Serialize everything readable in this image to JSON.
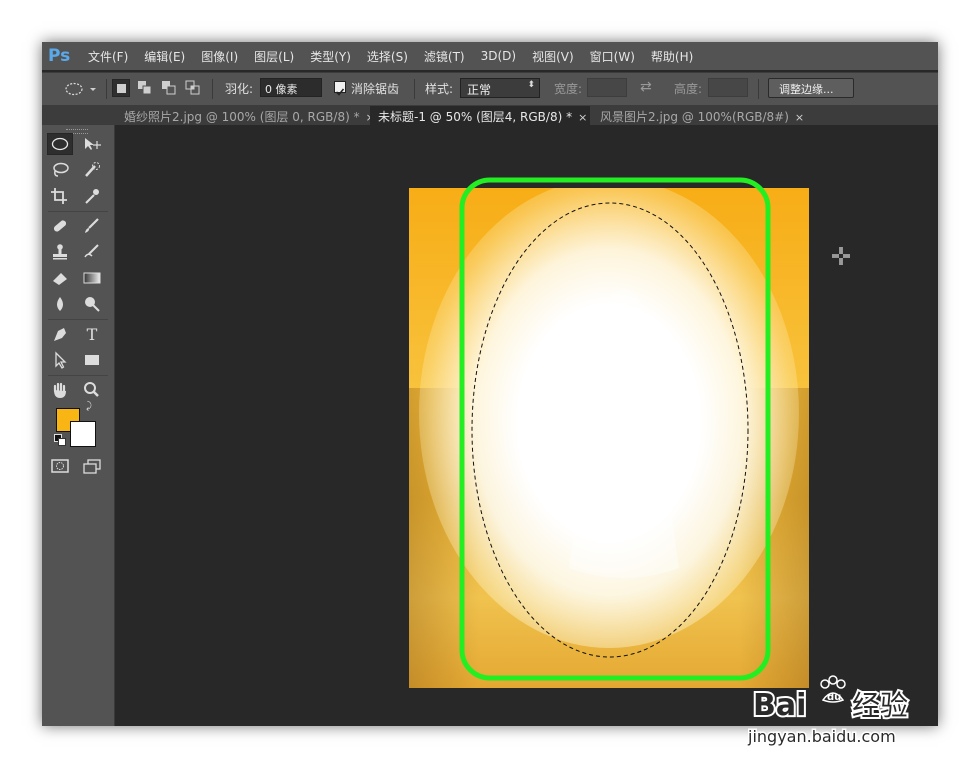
{
  "app": {
    "logo": "Ps"
  },
  "menu": [
    "文件(F)",
    "编辑(E)",
    "图像(I)",
    "图层(L)",
    "类型(Y)",
    "选择(S)",
    "滤镜(T)",
    "3D(D)",
    "视图(V)",
    "窗口(W)",
    "帮助(H)"
  ],
  "options": {
    "feather_label": "羽化:",
    "feather_value": "0 像素",
    "antialias_label": "消除锯齿",
    "antialias_checked": true,
    "style_label": "样式:",
    "style_value": "正常",
    "width_label": "宽度:",
    "height_label": "高度:",
    "refine_edge": "调整边缘..."
  },
  "tabs": [
    {
      "label": "婚纱照片2.jpg @ 100% (图层 0, RGB/8) *",
      "close": "×",
      "active": false
    },
    {
      "label": "未标题-1 @ 50% (图层4, RGB/8) *",
      "close": "×",
      "active": true
    },
    {
      "label": "风景图片2.jpg @ 100%(RGB/8#)",
      "close": "×",
      "active": false
    }
  ],
  "toolbox": {
    "tools": [
      "elliptical-marquee",
      "move",
      "lasso",
      "quick-selection",
      "crop",
      "eyedropper",
      "spot-healing-brush",
      "brush",
      "clone-stamp",
      "history-brush",
      "eraser",
      "gradient",
      "blur",
      "dodge",
      "pen",
      "type",
      "path-selection",
      "rectangle",
      "hand",
      "zoom"
    ],
    "type_glyph": "T",
    "foreground_color": "#f9b514",
    "background_color": "#ffffff"
  },
  "annotation": {
    "highlight_color": "#22ee22"
  },
  "watermark": {
    "brand_left": "Bai",
    "brand_right": "经验",
    "url": "jingyan.baidu.com"
  },
  "colors": {
    "ui_bg": "#535353",
    "canvas_bg": "#282828"
  }
}
